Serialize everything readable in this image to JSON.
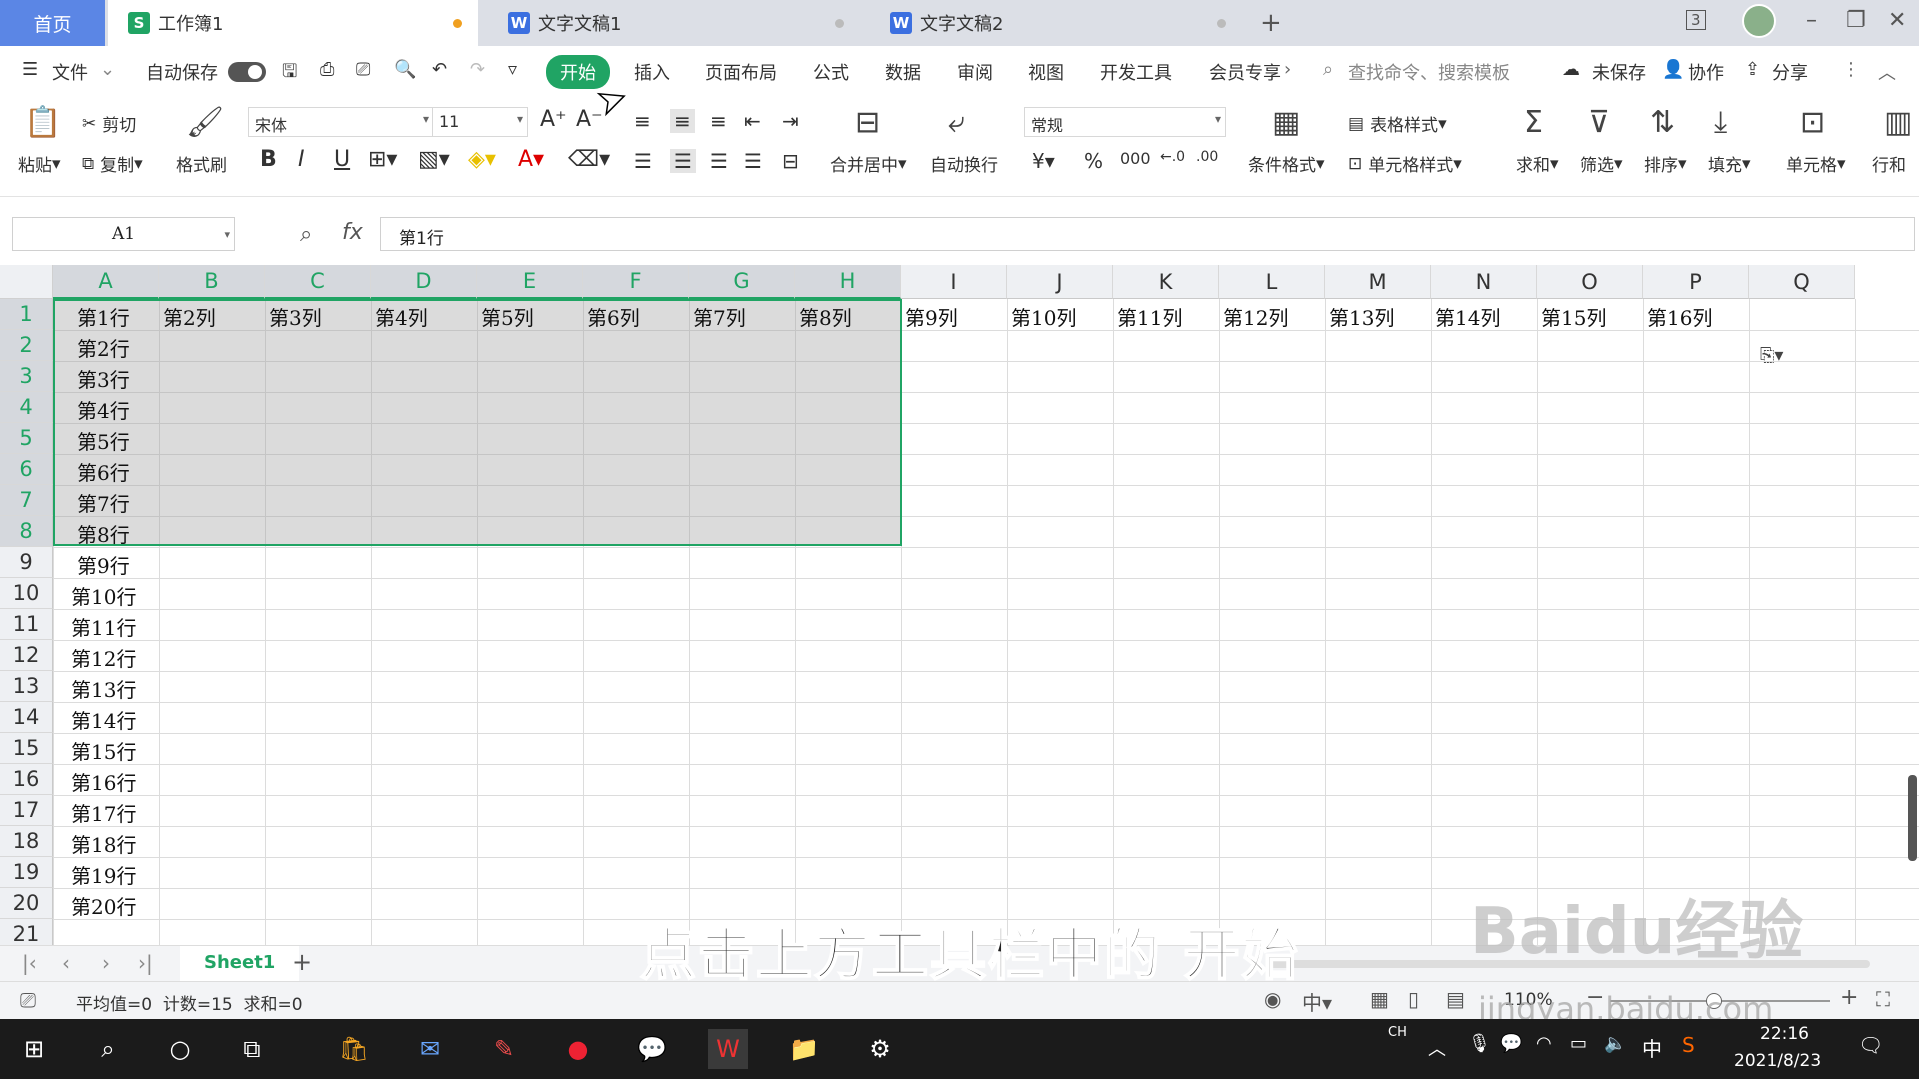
{
  "tabs": {
    "home": "首页",
    "docs": [
      {
        "name": "工作簿1",
        "icon_letter": "S",
        "color": "#20a464",
        "dot": "#f0a020"
      },
      {
        "name": "文字文稿1",
        "icon_letter": "W",
        "color": "#3b6fe0",
        "dot": "#bbbbbb"
      },
      {
        "name": "文字文稿2",
        "icon_letter": "W",
        "color": "#3b6fe0",
        "dot": "#bbbbbb"
      }
    ],
    "add": "+",
    "window_count": "3"
  },
  "ribbon_tabs": {
    "file": "文件",
    "autosave": "自动保存",
    "items": [
      "开始",
      "插入",
      "页面布局",
      "公式",
      "数据",
      "审阅",
      "视图",
      "开发工具",
      "会员专享"
    ],
    "active": "开始",
    "search_placeholder": "查找命令、搜索模板",
    "unsaved": "未保存",
    "collab": "协作",
    "share": "分享"
  },
  "ribbon": {
    "paste": "粘贴",
    "cut": "剪切",
    "copy": "复制",
    "format_painter": "格式刷",
    "font": "宋体",
    "size": "11",
    "merge_center": "合并居中",
    "wrap": "自动换行",
    "number_format": "常规",
    "percent": "%",
    "thousands": "000",
    "cond_format": "条件格式",
    "table_style": "表格样式",
    "cell_style": "单元格样式",
    "sum": "求和",
    "filter": "筛选",
    "sort": "排序",
    "fill": "填充",
    "cell": "单元格",
    "rowcol": "行和"
  },
  "formula_bar": {
    "name_box": "A1",
    "fx": "fx",
    "content": "第1行"
  },
  "columns": [
    "A",
    "B",
    "C",
    "D",
    "E",
    "F",
    "G",
    "H",
    "I",
    "J",
    "K",
    "L",
    "M",
    "N",
    "O",
    "P",
    "Q"
  ],
  "rows": [
    "1",
    "2",
    "3",
    "4",
    "5",
    "6",
    "7",
    "8",
    "9",
    "10",
    "11",
    "12",
    "13",
    "14",
    "15",
    "16",
    "17",
    "18",
    "19",
    "20",
    "21"
  ],
  "row1": [
    "第1行",
    "第2列",
    "第3列",
    "第4列",
    "第5列",
    "第6列",
    "第7列",
    "第8列",
    "第9列",
    "第10列",
    "第11列",
    "第12列",
    "第13列",
    "第14列",
    "第15列",
    "第16列"
  ],
  "colA": [
    "第2行",
    "第3行",
    "第4行",
    "第5行",
    "第6行",
    "第7行",
    "第8行",
    "第9行",
    "第10行",
    "第11行",
    "第12行",
    "第13行",
    "第14行",
    "第15行",
    "第16行",
    "第17行",
    "第18行",
    "第19行",
    "第20行"
  ],
  "sheet": {
    "name": "Sheet1",
    "add": "+"
  },
  "status": {
    "stats": "平均值=0  计数=15  求和=0",
    "zoom": "110%"
  },
  "caption": "点击上方工具栏中的 开始",
  "watermark": "Baidu经验",
  "watermark_url": "jingyan.baidu.com",
  "taskbar": {
    "lang": "CH",
    "ime": "中",
    "time": "22:16",
    "date": "2021/8/23"
  }
}
